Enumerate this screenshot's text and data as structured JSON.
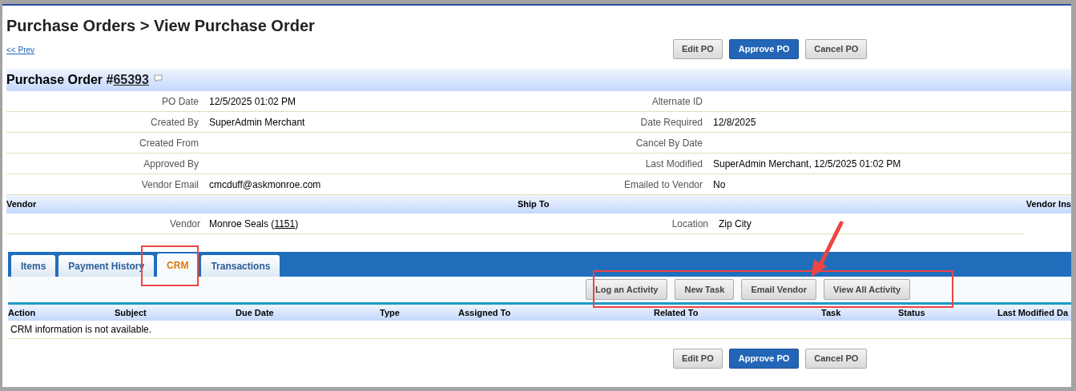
{
  "page_title": "Purchase Orders > View Purchase Order",
  "prev_link": "<< Prev",
  "action_buttons_top": [
    {
      "label": "Edit PO",
      "primary": false
    },
    {
      "label": "Approve PO",
      "primary": true
    },
    {
      "label": "Cancel PO",
      "primary": false
    }
  ],
  "po_header": {
    "title": "Purchase Order #",
    "number": "65393"
  },
  "details_left": [
    {
      "label": "PO Date",
      "value": "12/5/2025 01:02 PM"
    },
    {
      "label": "Created By",
      "value": "SuperAdmin Merchant"
    },
    {
      "label": "Created From"
    },
    {
      "label": "Approved By"
    },
    {
      "label": "Vendor Email",
      "value": "cmcduff@askmonroe.com"
    }
  ],
  "details_right": [
    {
      "label": "Alternate ID"
    },
    {
      "label": "Date Required",
      "value": "12/8/2025"
    },
    {
      "label": "Cancel By Date"
    },
    {
      "label": "Last Modified",
      "value": "SuperAdmin Merchant, 12/5/2025 01:02 PM"
    },
    {
      "label": "Emailed to Vendor",
      "value": "No"
    }
  ],
  "vendor_section": {
    "headers": [
      "Vendor",
      "Ship To",
      "Vendor Ins"
    ],
    "vendor_label": "Vendor",
    "vendor_name": "Monroe Seals (",
    "vendor_id": "1151",
    "vendor_close": ")",
    "location_label": "Location",
    "location_value": "Zip City"
  },
  "tabs": [
    {
      "label": "Items",
      "selected": false
    },
    {
      "label": "Payment History",
      "selected": false
    },
    {
      "label": "CRM",
      "selected": true
    },
    {
      "label": "Transactions",
      "selected": false
    }
  ],
  "crm_buttons": [
    "Log an Activity",
    "New Task",
    "Email Vendor",
    "View All Activity"
  ],
  "table": {
    "columns": [
      "Action",
      "Subject",
      "Due Date",
      "Type",
      "Assigned To",
      "Related To",
      "Task",
      "Status",
      "Last Modified Da"
    ],
    "empty_message": "CRM information is not available."
  },
  "action_buttons_bottom": [
    {
      "label": "Edit PO",
      "primary": false
    },
    {
      "label": "Approve PO",
      "primary": true
    },
    {
      "label": "Cancel PO",
      "primary": false
    }
  ]
}
